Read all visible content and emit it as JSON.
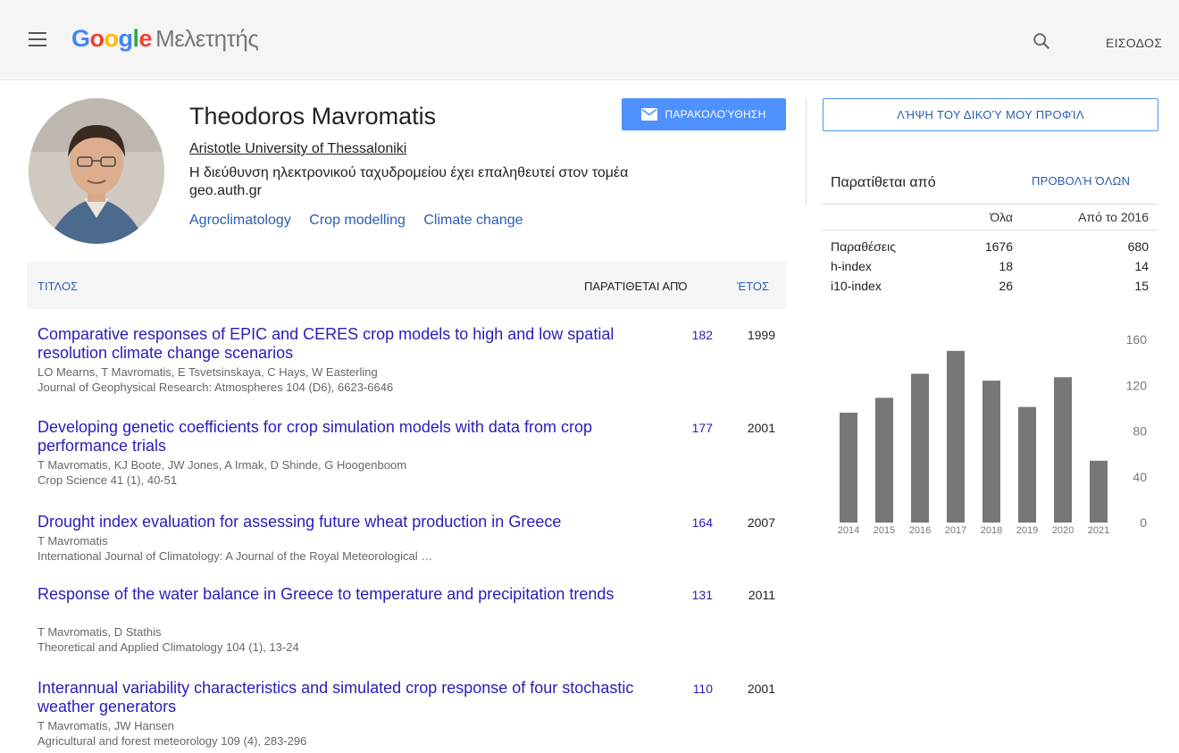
{
  "header": {
    "logo_letters": [
      {
        "ch": "G",
        "color": "#4285F4"
      },
      {
        "ch": "o",
        "color": "#EA4335"
      },
      {
        "ch": "o",
        "color": "#FBBC05"
      },
      {
        "ch": "g",
        "color": "#4285F4"
      },
      {
        "ch": "l",
        "color": "#34A853"
      },
      {
        "ch": "e",
        "color": "#EA4335"
      }
    ],
    "product": "Μελετητής",
    "signin_label": "ΕΙΣΟΔΟΣ"
  },
  "profile": {
    "name": "Theodoros Mavromatis",
    "affiliation": "Aristotle University of Thessaloniki",
    "email_line1": "Η διεύθυνση ηλεκτρονικού ταχυδρομείου έχει επαληθευτεί στον τομέα",
    "email_line2": "geo.auth.gr",
    "tags": [
      "Agroclimatology",
      "Crop modelling",
      "Climate change"
    ],
    "follow_label": "ΠΑΡΑΚΟΛΟΎΘΗΣΗ"
  },
  "table": {
    "col_title": "ΤΙΤΛΟΣ",
    "col_cited": "ΠΑΡΑΤΊΘΕΤΑΙ ΑΠΌ",
    "col_year": "ΈΤΟΣ",
    "rows": [
      {
        "title": "Comparative responses of EPIC and CERES crop models to high and low spatial resolution climate change scenarios",
        "authors": "LO Mearns, T Mavromatis, E Tsvetsinskaya, C Hays, W Easterling",
        "venue": "Journal of Geophysical Research: Atmospheres 104 (D6), 6623-6646",
        "cited": "182",
        "year": "1999"
      },
      {
        "title": "Developing genetic coefficients for crop simulation models with data from crop performance trials",
        "authors": "T Mavromatis, KJ Boote, JW Jones, A Irmak, D Shinde, G Hoogenboom",
        "venue": "Crop Science 41 (1), 40-51",
        "cited": "177",
        "year": "2001"
      },
      {
        "title": "Drought index evaluation for assessing future wheat production in Greece",
        "authors": "T Mavromatis",
        "venue": "International Journal of Climatology: A Journal of the Royal Meteorological …",
        "cited": "164",
        "year": "2007"
      },
      {
        "title": "Response of the water balance in Greece to temperature and precipitation trends",
        "authors": "T Mavromatis, D Stathis",
        "venue": "Theoretical and Applied Climatology 104 (1), 13-24",
        "cited": "131",
        "year": "2011"
      },
      {
        "title": "Interannual variability characteristics and simulated crop response of four stochastic weather generators",
        "authors": "T Mavromatis, JW Hansen",
        "venue": "Agricultural and forest meteorology 109 (4), 283-296",
        "cited": "110",
        "year": "2001"
      }
    ]
  },
  "sidebar": {
    "myprofile_label": "ΛΉΨΗ ΤΟΥ ΔΙΚΟΎ ΜΟΥ ΠΡΟΦΊΛ",
    "cited_by": "Παρατίθεται από",
    "view_all": "ΠΡΟΒΟΛΉ ΌΛΩΝ",
    "col_all": "Όλα",
    "col_since": "Από το 2016",
    "stats": [
      {
        "label": "Παραθέσεις",
        "all": "1676",
        "since": "680"
      },
      {
        "label": "h-index",
        "all": "18",
        "since": "14"
      },
      {
        "label": "i10-index",
        "all": "26",
        "since": "15"
      }
    ]
  },
  "chart_data": {
    "type": "bar",
    "categories": [
      "2014",
      "2015",
      "2016",
      "2017",
      "2018",
      "2019",
      "2020",
      "2021"
    ],
    "values": [
      96,
      109,
      130,
      150,
      124,
      101,
      127,
      54
    ],
    "yticks": [
      "0",
      "40",
      "80",
      "120",
      "160"
    ],
    "ylim": [
      0,
      160
    ],
    "bar_color": "#777777"
  }
}
